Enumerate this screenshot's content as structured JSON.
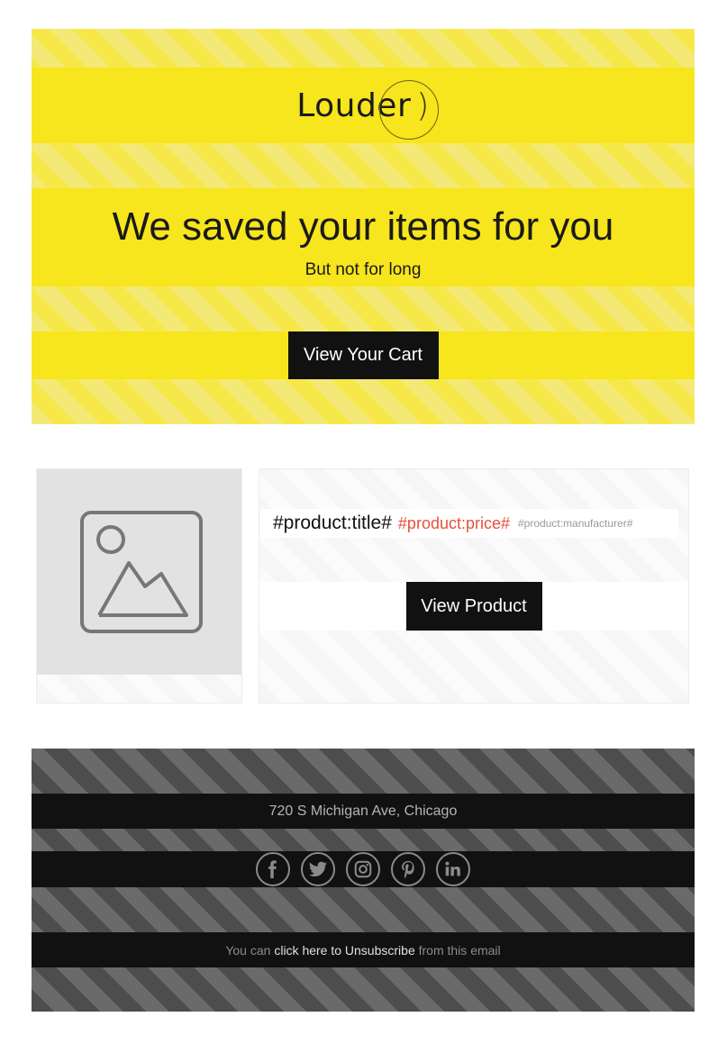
{
  "header": {
    "logo_text": "Louder",
    "logo_mark": ")",
    "headline": "We saved your items for you",
    "subline": "But not for long",
    "cta_label": "View Your Cart"
  },
  "product": {
    "image_icon": "image-placeholder-icon",
    "title": "#product:title#",
    "price": "#product:price#",
    "manufacturer": "#product:manufacturer#",
    "button_label": "View Product"
  },
  "footer": {
    "address": "720 S Michigan Ave, Chicago",
    "social": [
      {
        "name": "facebook",
        "icon": "facebook-icon"
      },
      {
        "name": "twitter",
        "icon": "twitter-icon"
      },
      {
        "name": "instagram",
        "icon": "instagram-icon"
      },
      {
        "name": "pinterest",
        "icon": "pinterest-icon"
      },
      {
        "name": "linkedin",
        "icon": "linkedin-icon"
      }
    ],
    "unsubscribe_prefix": "You can ",
    "unsubscribe_link": "click here to Unsubscribe",
    "unsubscribe_suffix": " from this email"
  },
  "colors": {
    "brand_yellow": "#f7e51d",
    "dark": "#111111",
    "price_red": "#e8503a"
  }
}
